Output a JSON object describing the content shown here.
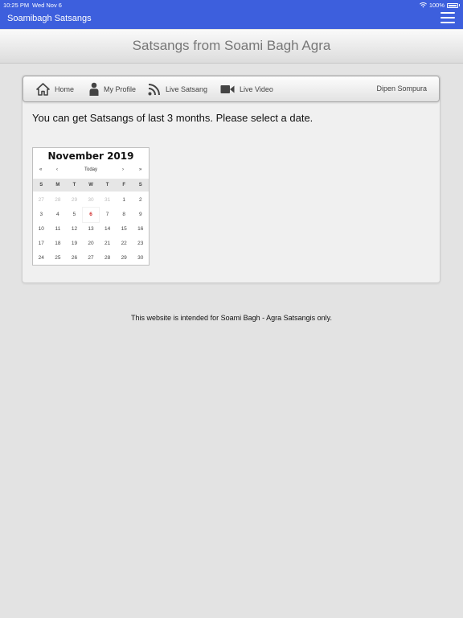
{
  "status_bar": {
    "time": "10:25 PM",
    "date": "Wed Nov 6",
    "battery": "100%"
  },
  "app": {
    "title": "Soamibagh Satsangs"
  },
  "header": {
    "title": "Satsangs from Soami Bagh Agra"
  },
  "nav": {
    "home": "Home",
    "profile": "My Profile",
    "live_satsang": "Live Satsang",
    "live_video": "Live Video",
    "user": "Dipen Sompura"
  },
  "instruction": "You can get Satsangs of last 3 months. Please select a date.",
  "calendar": {
    "month_title": "November 2019",
    "prev_year": "«",
    "prev_month": "‹",
    "today_label": "Today",
    "next_month": "›",
    "next_year": "»",
    "weekdays": [
      "S",
      "M",
      "T",
      "W",
      "T",
      "F",
      "S"
    ],
    "weeks": [
      [
        "27",
        "28",
        "29",
        "30",
        "31",
        "1",
        "2"
      ],
      [
        "3",
        "4",
        "5",
        "6",
        "7",
        "8",
        "9"
      ],
      [
        "10",
        "11",
        "12",
        "13",
        "14",
        "15",
        "16"
      ],
      [
        "17",
        "18",
        "19",
        "20",
        "21",
        "22",
        "23"
      ],
      [
        "24",
        "25",
        "26",
        "27",
        "28",
        "29",
        "30"
      ]
    ],
    "today": "6"
  },
  "footer": "This website is intended for Soami Bagh - Agra Satsangis only.",
  "colors": {
    "topbar": "#3d5fdd",
    "today": "#d02b2b"
  }
}
